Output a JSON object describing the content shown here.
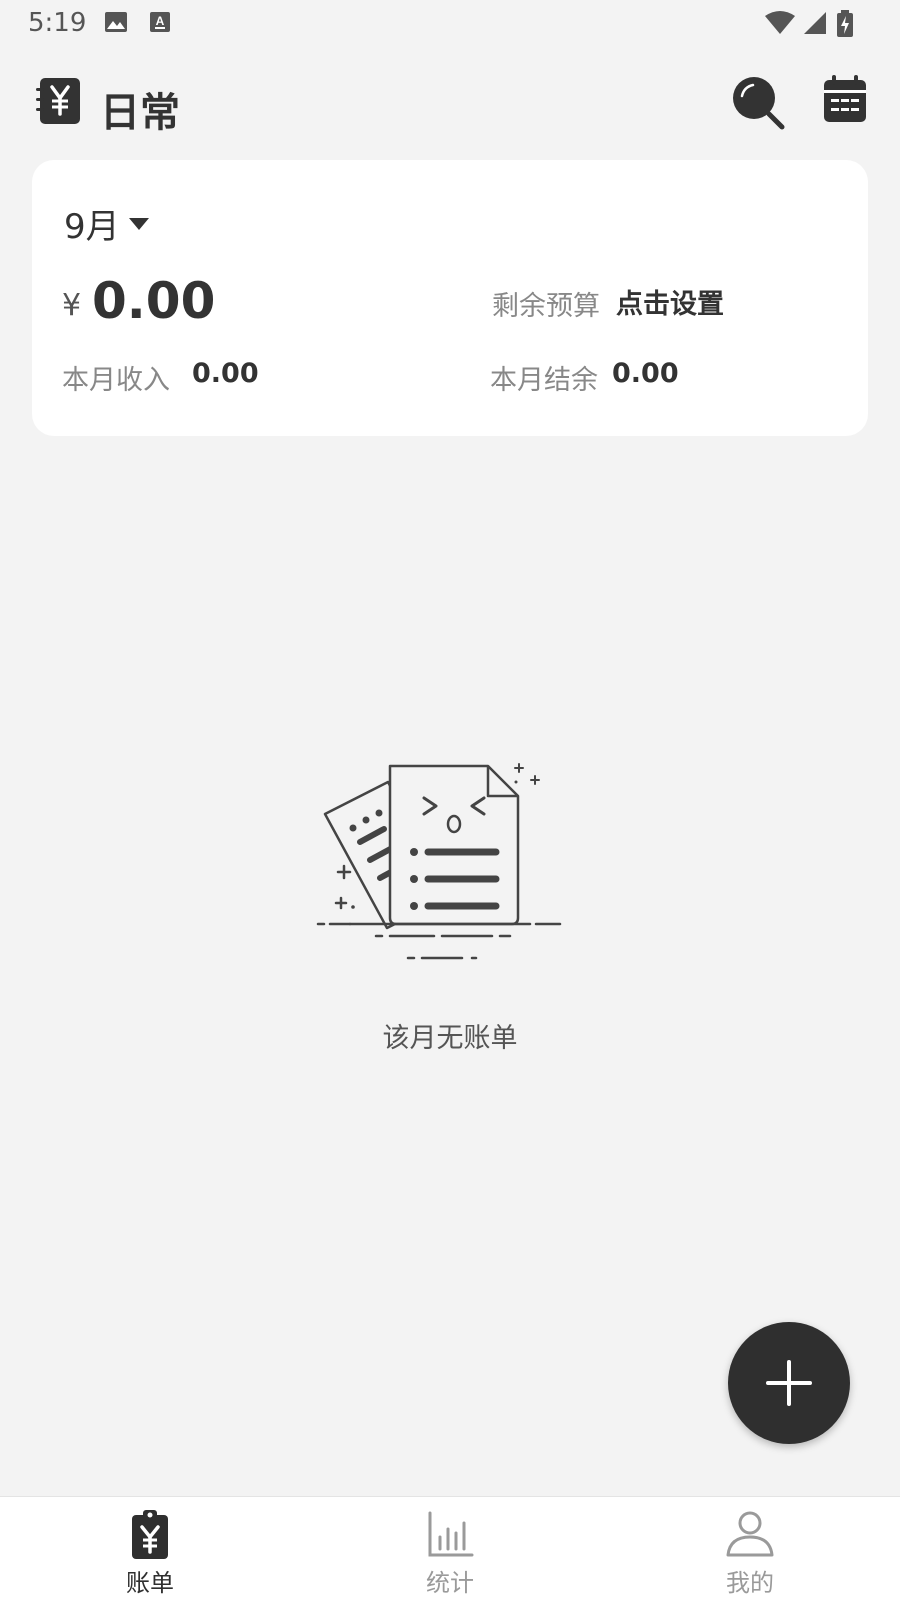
{
  "status_bar": {
    "time": "5:19",
    "icons": [
      "image-icon",
      "keyboard-a-icon",
      "wifi-icon",
      "signal-icon",
      "battery-charging-icon"
    ]
  },
  "app_bar": {
    "ledger_icon": "ledger-yen-icon",
    "title": "日常",
    "search_icon": "search-icon",
    "calendar_icon": "calendar-icon"
  },
  "summary": {
    "month": "9月",
    "currency_symbol": "¥",
    "balance": "0.00",
    "budget_label": "剩余预算",
    "budget_action": "点击设置",
    "income_label": "本月收入",
    "income_value": "0.00",
    "surplus_label": "本月结余",
    "surplus_value": "0.00"
  },
  "empty_state": {
    "icon": "empty-bills-icon",
    "text": "该月无账单"
  },
  "fab": {
    "icon": "plus-icon"
  },
  "bottom_nav": {
    "items": [
      {
        "label": "账单",
        "icon": "bill-icon",
        "active": true
      },
      {
        "label": "统计",
        "icon": "chart-icon",
        "active": false
      },
      {
        "label": "我的",
        "icon": "person-icon",
        "active": false
      }
    ]
  },
  "colors": {
    "background": "#f3f3f3",
    "card": "#ffffff",
    "primary_dark": "#333333",
    "muted_text": "#888888",
    "inactive_nav": "#9a9a9a",
    "fab": "#2f2f2f"
  }
}
